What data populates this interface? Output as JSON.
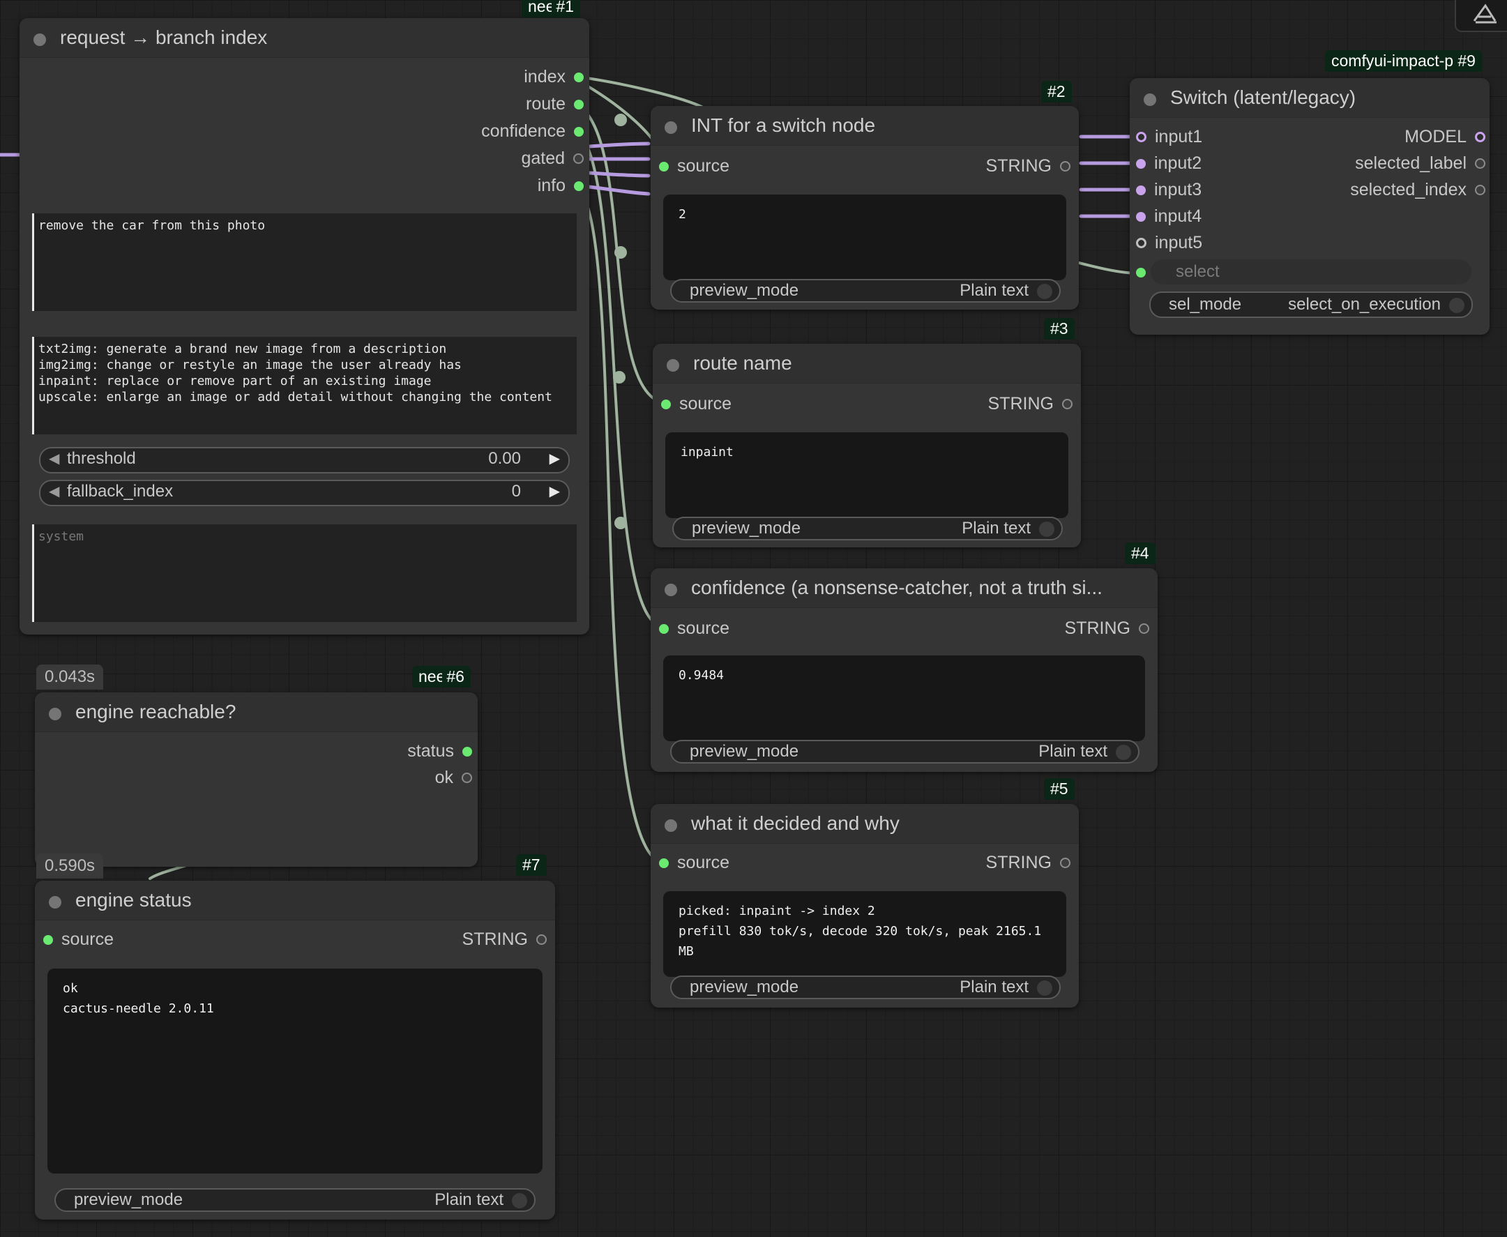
{
  "nodes": {
    "n1": {
      "badge_id": "#1",
      "badge_name": "nee",
      "title": "request → branch index",
      "outputs": [
        "index",
        "route",
        "confidence",
        "gated",
        "info"
      ],
      "request_text": "remove the car from this photo",
      "routes_text": "txt2img: generate a brand new image from a description\nimg2img: change or restyle an image the user already has\ninpaint: replace or remove part of an existing image\nupscale: enlarge an image or add detail without changing the content",
      "threshold_label": "threshold",
      "threshold_value": "0.00",
      "fallback_label": "fallback_index",
      "fallback_value": "0",
      "system_placeholder": "system"
    },
    "n2": {
      "badge_id": "#2",
      "title": "INT for a switch node",
      "input": "source",
      "output": "STRING",
      "display": "2",
      "preview_label": "preview_mode",
      "preview_value": "Plain text"
    },
    "n3": {
      "badge_id": "#3",
      "title": "route name",
      "input": "source",
      "output": "STRING",
      "display": "inpaint",
      "preview_label": "preview_mode",
      "preview_value": "Plain text"
    },
    "n4": {
      "badge_id": "#4",
      "title": "confidence (a nonsense-catcher, not a truth si...",
      "input": "source",
      "output": "STRING",
      "display": "0.9484",
      "preview_label": "preview_mode",
      "preview_value": "Plain text"
    },
    "n5": {
      "badge_id": "#5",
      "title": "what it decided and why",
      "input": "source",
      "output": "STRING",
      "display": "picked: inpaint -> index 2\nprefill 830 tok/s, decode 320 tok/s, peak 2165.1 MB",
      "preview_label": "preview_mode",
      "preview_value": "Plain text"
    },
    "n6": {
      "badge_id": "#6",
      "badge_name": "nee",
      "timing_top": "0.043s",
      "timing_bottom": "0.590s",
      "title": "engine reachable?",
      "outputs": [
        "status",
        "ok"
      ]
    },
    "n7": {
      "badge_id": "#7",
      "title": "engine status",
      "input": "source",
      "output": "STRING",
      "display": "ok\ncactus-needle 2.0.11",
      "preview_label": "preview_mode",
      "preview_value": "Plain text"
    },
    "n9": {
      "badge_id": "#9",
      "badge_name": "comfyui-impact-pack",
      "title": "Switch (latent/legacy)",
      "inputs": [
        "input1",
        "input2",
        "input3",
        "input4",
        "input5"
      ],
      "outputs": [
        "MODEL",
        "selected_label",
        "selected_index"
      ],
      "select_label": "select",
      "sel_mode_label": "sel_mode",
      "sel_mode_value": "select_on_execution"
    }
  },
  "colors": {
    "canvas": "#212121",
    "node_body": "#353535",
    "link_string": "#9fb39f",
    "link_any": "#b79be0",
    "slot_connected": "#6bea72",
    "badge_bg": "#0b2616"
  }
}
